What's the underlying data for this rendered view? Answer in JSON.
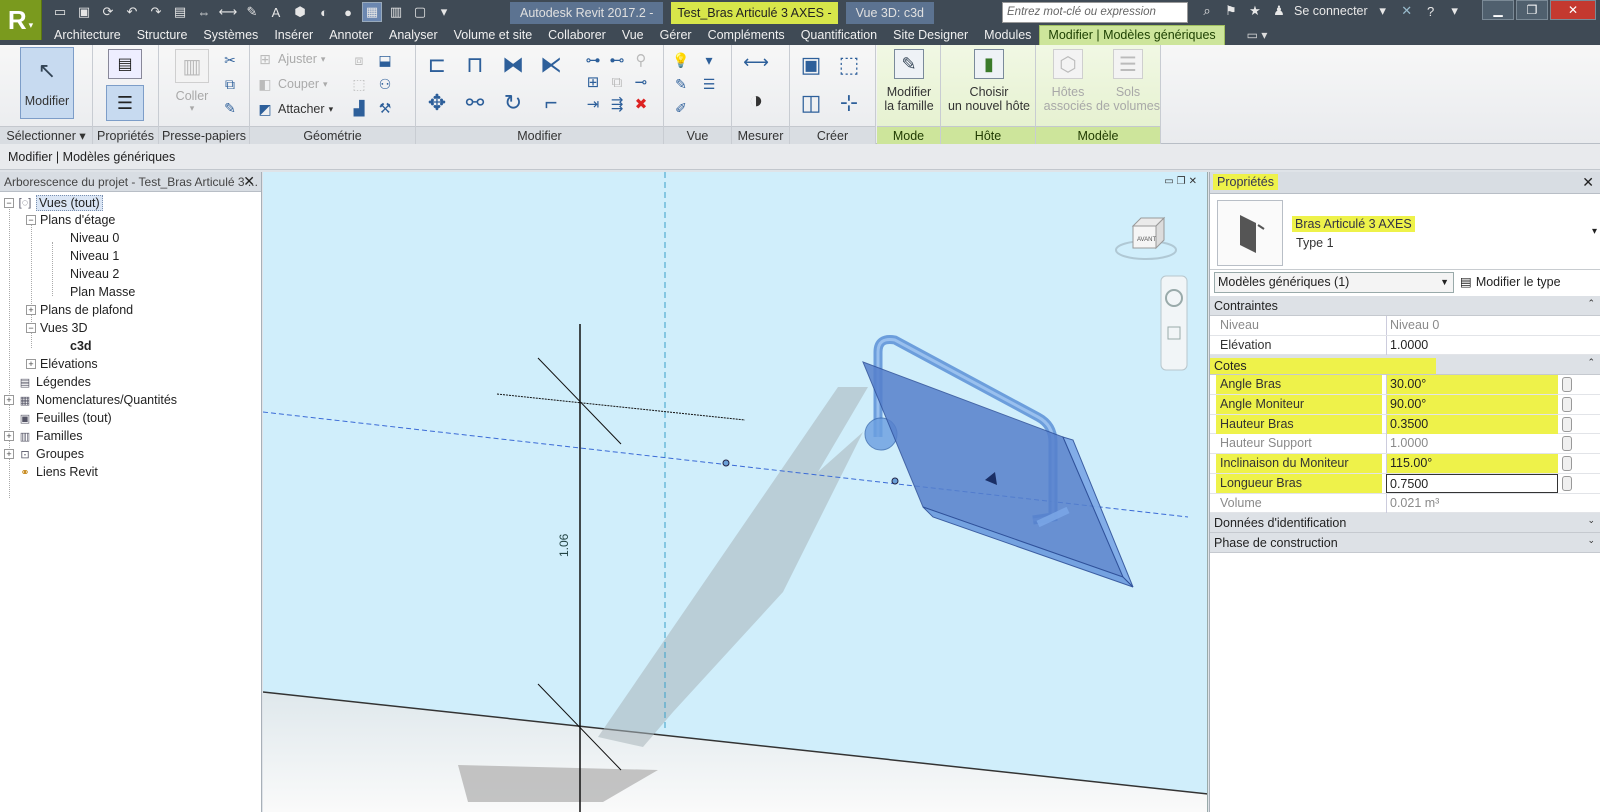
{
  "app": {
    "logo_letter": "R",
    "title_app": "Autodesk Revit 2017.2 -",
    "title_project": "Test_Bras Articulé 3 AXES -",
    "title_view": "Vue 3D: c3d",
    "search_placeholder": "Entrez mot-clé ou expression",
    "signin": "Se connecter"
  },
  "tabs": [
    "Architecture",
    "Structure",
    "Systèmes",
    "Insérer",
    "Annoter",
    "Analyser",
    "Volume et site",
    "Collaborer",
    "Vue",
    "Gérer",
    "Compléments",
    "Quantification",
    "Site Designer",
    "Modules",
    "Modifier | Modèles génériques"
  ],
  "ribbon": {
    "modify": "Modifier",
    "copy": "Coller",
    "trim": "Ajuster",
    "cut": "Couper",
    "attach": "Attacher",
    "edit_family": "Modifier la famille",
    "edit_family_l1": "Modifier",
    "edit_family_l2": "la famille",
    "host_l1": "Choisir",
    "host_l2": "un nouvel hôte",
    "assoc_hosts_l1": "Hôtes",
    "assoc_hosts_l2": "associés",
    "mass_floors_l1": "Sols",
    "mass_floors_l2": "de volumes",
    "panels": {
      "select": "Sélectionner",
      "properties": "Propriétés",
      "clipboard": "Presse-papiers",
      "geometry": "Géométrie",
      "modify": "Modifier",
      "view": "Vue",
      "measure": "Mesurer",
      "create": "Créer",
      "mode": "Mode",
      "host": "Hôte",
      "model": "Modèle"
    }
  },
  "optionsbar": {
    "text": "Modifier | Modèles génériques"
  },
  "browser": {
    "title": "Arborescence du projet - Test_Bras Articulé 3 ...",
    "items": {
      "views": "Vues (tout)",
      "floor_plans": "Plans d'étage",
      "level0": "Niveau 0",
      "level1": "Niveau 1",
      "level2": "Niveau 2",
      "site": "Plan Masse",
      "ceiling": "Plans de plafond",
      "views3d": "Vues 3D",
      "c3d": "c3d",
      "elevations": "Elévations",
      "legends": "Légendes",
      "schedules": "Nomenclatures/Quantités",
      "sheets": "Feuilles (tout)",
      "families": "Familles",
      "groups": "Groupes",
      "links": "Liens Revit"
    }
  },
  "viewport": {
    "dimension_label": "1.06",
    "viewcube_label": "AVANT"
  },
  "properties": {
    "title": "Propriétés",
    "family_name": "Bras Articulé 3 AXES",
    "type_name": "Type 1",
    "selector": "Modèles génériques (1)",
    "edit_type": "Modifier le type",
    "groups": {
      "constraints": "Contraintes",
      "dimensions": "Cotes",
      "identity": "Données d'identification",
      "phasing": "Phase de construction"
    },
    "constraints": [
      {
        "key": "Niveau",
        "value": "Niveau 0"
      },
      {
        "key": "Elévation",
        "value": "1.0000"
      }
    ],
    "dimensions": [
      {
        "key": "Angle Bras",
        "value": "30.00°"
      },
      {
        "key": "Angle Moniteur",
        "value": "90.00°"
      },
      {
        "key": "Hauteur Bras",
        "value": "0.3500"
      },
      {
        "key": "Hauteur Support",
        "value": "1.0000"
      },
      {
        "key": "Inclinaison du Moniteur",
        "value": "115.00°"
      },
      {
        "key": "Longueur Bras",
        "value": "0.7500"
      },
      {
        "key": "Volume",
        "value": "0.021 m³"
      }
    ]
  },
  "colors": {
    "highlight": "#eef24a",
    "context_tab": "#cde59b",
    "viewport_bg": "#d0eefb",
    "object_blue": "#5b8fd6"
  }
}
